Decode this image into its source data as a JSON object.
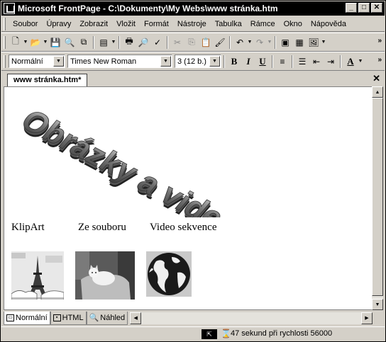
{
  "window": {
    "title": "Microsoft FrontPage - C:\\Dokumenty\\My Webs\\www stránka.htm"
  },
  "menu": [
    "Soubor",
    "Úpravy",
    "Zobrazit",
    "Vložit",
    "Formát",
    "Nástroje",
    "Tabulka",
    "Rámce",
    "Okno",
    "Nápověda"
  ],
  "format_toolbar": {
    "style": "Normální",
    "font": "Times New Roman",
    "size": "3 (12 b.)",
    "bold": "B",
    "italic": "I",
    "underline": "U",
    "color_letter": "A"
  },
  "document": {
    "tab": "www stránka.htm*",
    "wordart_text": "Obrázky a video",
    "labels": [
      "KlipArt",
      "Ze souboru",
      "Video sekvence"
    ]
  },
  "view_tabs": [
    "Normální",
    "HTML",
    "Náhled"
  ],
  "status": {
    "text": "47 sekund při rychlosti 56000"
  }
}
